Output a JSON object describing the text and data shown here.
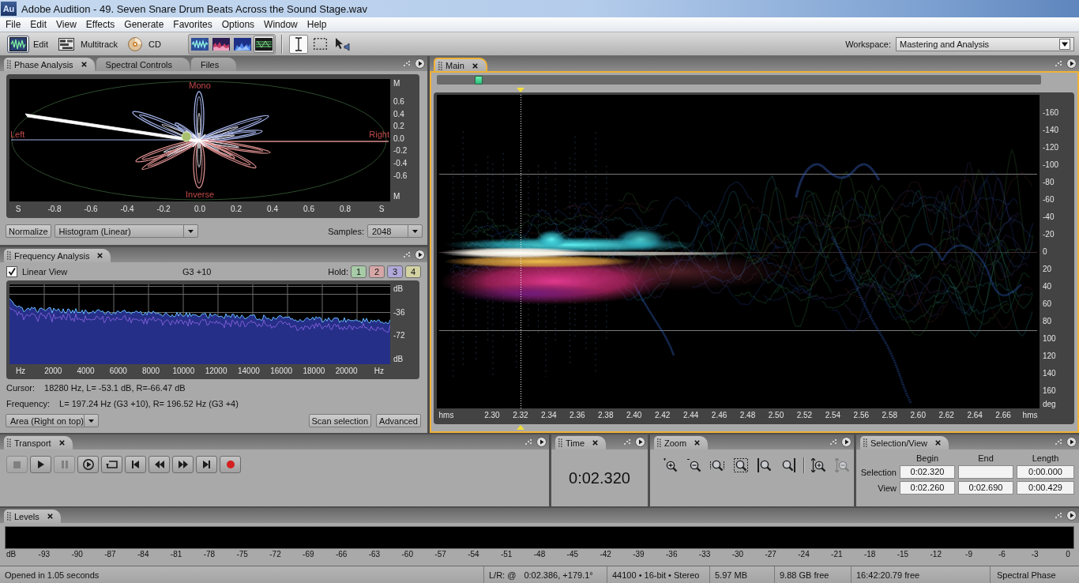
{
  "window": {
    "app_icon": "Au",
    "title": "Adobe Audition - 49. Seven Snare Drum Beats Across the Sound Stage.wav"
  },
  "menu": [
    "File",
    "Edit",
    "View",
    "Effects",
    "Generate",
    "Favorites",
    "Options",
    "Window",
    "Help"
  ],
  "toolbar": {
    "modes": [
      {
        "kind": "edit",
        "label": "Edit",
        "selected": true
      },
      {
        "kind": "multitrack",
        "label": "Multitrack",
        "selected": false
      },
      {
        "kind": "cd",
        "label": "CD",
        "selected": false
      }
    ],
    "views": [
      {
        "kind": "waveform",
        "selected": false
      },
      {
        "kind": "spectral-frequency",
        "selected": false
      },
      {
        "kind": "spectral-pan",
        "selected": false
      },
      {
        "kind": "spectral-phase",
        "selected": true
      }
    ],
    "tools": [
      {
        "kind": "time-selection",
        "selected": true
      },
      {
        "kind": "marquee",
        "selected": false
      },
      {
        "kind": "hybrid",
        "selected": false
      }
    ],
    "workspace": {
      "label": "Workspace:",
      "value": "Mastering and Analysis"
    }
  },
  "phase_panel": {
    "tabs": [
      {
        "label": "Phase Analysis",
        "selected": true
      },
      {
        "label": "Spectral Controls",
        "selected": false
      },
      {
        "label": "Files",
        "selected": false
      }
    ],
    "plot": {
      "top_label": "Mono",
      "left_label": "Left",
      "right_label": "Right",
      "bottom_label": "Inverse",
      "y_ticks": [
        "M",
        "0.6",
        "0.4",
        "0.2",
        "0.0",
        "-0.2",
        "-0.4",
        "-0.6",
        "M"
      ],
      "x_ticks": [
        "S",
        "-0.8",
        "-0.6",
        "-0.4",
        "-0.2",
        "0.0",
        "0.2",
        "0.4",
        "0.6",
        "0.8",
        "S"
      ]
    },
    "normalize": "Normalize",
    "display": "Histogram (Linear)",
    "samples_label": "Samples:",
    "samples": "2048"
  },
  "frequency_panel": {
    "tabs": [
      {
        "label": "Frequency Analysis",
        "selected": true
      }
    ],
    "linear_view": {
      "label": "Linear View",
      "checked": true
    },
    "note": "G3 +10",
    "hold_label": "Hold:",
    "hold": [
      {
        "label": "1",
        "color": "#a6cba6"
      },
      {
        "label": "2",
        "color": "#d6a6a6"
      },
      {
        "label": "3",
        "color": "#b0a8d8"
      },
      {
        "label": "4",
        "color": "#d2d2a2"
      }
    ],
    "plot": {
      "y_ticks": [
        "dB",
        "-36",
        "-72",
        "dB"
      ],
      "x_ticks": [
        "Hz",
        "2000",
        "4000",
        "6000",
        "8000",
        "10000",
        "12000",
        "14000",
        "16000",
        "18000",
        "20000",
        "Hz"
      ]
    },
    "cursor_label": "Cursor:",
    "cursor": "18280 Hz, L= -53.1 dB, R=-66.47 dB",
    "frequency_label": "Frequency:",
    "frequency": "L= 197.24 Hz (G3 +10), R= 196.52 Hz (G3 +4)",
    "display": "Area (Right on top)",
    "buttons": [
      "Scan selection",
      "Advanced"
    ]
  },
  "main_panel": {
    "tabs": [
      {
        "label": "Main",
        "selected": true
      }
    ],
    "y_ticks": [
      "-160",
      "-140",
      "-120",
      "-100",
      "-80",
      "-60",
      "-40",
      "-20",
      "0",
      "20",
      "40",
      "60",
      "80",
      "100",
      "120",
      "140",
      "160",
      "deg"
    ],
    "x_ticks": [
      "hms",
      "2.30",
      "2.32",
      "2.34",
      "2.36",
      "2.38",
      "2.40",
      "2.42",
      "2.44",
      "2.46",
      "2.48",
      "2.50",
      "2.52",
      "2.54",
      "2.56",
      "2.58",
      "2.60",
      "2.62",
      "2.64",
      "2.66",
      "hms"
    ]
  },
  "transport_panel": {
    "tabs": [
      {
        "label": "Transport",
        "selected": true
      }
    ],
    "buttons": [
      {
        "kind": "stop",
        "disabled": true
      },
      {
        "kind": "play",
        "disabled": false
      },
      {
        "kind": "pause",
        "disabled": true
      },
      {
        "kind": "play-to-end",
        "disabled": false
      },
      {
        "kind": "loop",
        "disabled": false
      },
      {
        "kind": "go-to-start",
        "disabled": false
      },
      {
        "kind": "rewind",
        "disabled": false
      },
      {
        "kind": "fast-forward",
        "disabled": false
      },
      {
        "kind": "go-to-end",
        "disabled": false
      },
      {
        "kind": "record",
        "disabled": false
      }
    ]
  },
  "time_panel": {
    "tabs": [
      {
        "label": "Time",
        "selected": true
      }
    ],
    "time": "0:02.320"
  },
  "zoom_panel": {
    "tabs": [
      {
        "label": "Zoom",
        "selected": true
      }
    ],
    "horizontal_buttons": [
      {
        "kind": "zoom-in",
        "disabled": false
      },
      {
        "kind": "zoom-out",
        "disabled": false
      },
      {
        "kind": "zoom-full",
        "disabled": false
      },
      {
        "kind": "zoom-selection",
        "disabled": false
      },
      {
        "kind": "zoom-to-left",
        "disabled": false
      },
      {
        "kind": "zoom-to-right",
        "disabled": false
      }
    ],
    "vertical_buttons": [
      {
        "kind": "vertical-zoom-in",
        "disabled": false
      },
      {
        "kind": "vertical-zoom-out",
        "disabled": true
      }
    ]
  },
  "selection_panel": {
    "tabs": [
      {
        "label": "Selection/View",
        "selected": true
      }
    ],
    "columns": [
      "Begin",
      "End",
      "Length"
    ],
    "rows": [
      {
        "label": "Selection",
        "cells": [
          {
            "value": "0:02.320"
          },
          {},
          {
            "value": "0:00.000"
          }
        ]
      },
      {
        "label": "View",
        "cells": [
          {
            "value": "0:02.260"
          },
          {
            "value": "0:02.690"
          },
          {
            "value": "0:00.429"
          }
        ]
      }
    ]
  },
  "levels_panel": {
    "tabs": [
      {
        "label": "Levels",
        "selected": true
      }
    ],
    "ticks": [
      "dB",
      "-93",
      "-90",
      "-87",
      "-84",
      "-81",
      "-78",
      "-75",
      "-72",
      "-69",
      "-66",
      "-63",
      "-60",
      "-57",
      "-54",
      "-51",
      "-48",
      "-45",
      "-42",
      "-39",
      "-36",
      "-33",
      "-30",
      "-27",
      "-24",
      "-21",
      "-18",
      "-15",
      "-12",
      "-9",
      "-6",
      "-3",
      "0"
    ]
  },
  "status_bar": {
    "message": "Opened in 1.05 seconds",
    "fields": [
      [
        "L/R: @",
        "0:02.386, +179.1°"
      ],
      [
        "44100 • 16-bit • Stereo"
      ],
      [
        "5.97 MB"
      ],
      [
        "9.88 GB free"
      ],
      [
        "16:42:20.79 free"
      ],
      [
        "Spectral Phase"
      ]
    ]
  }
}
